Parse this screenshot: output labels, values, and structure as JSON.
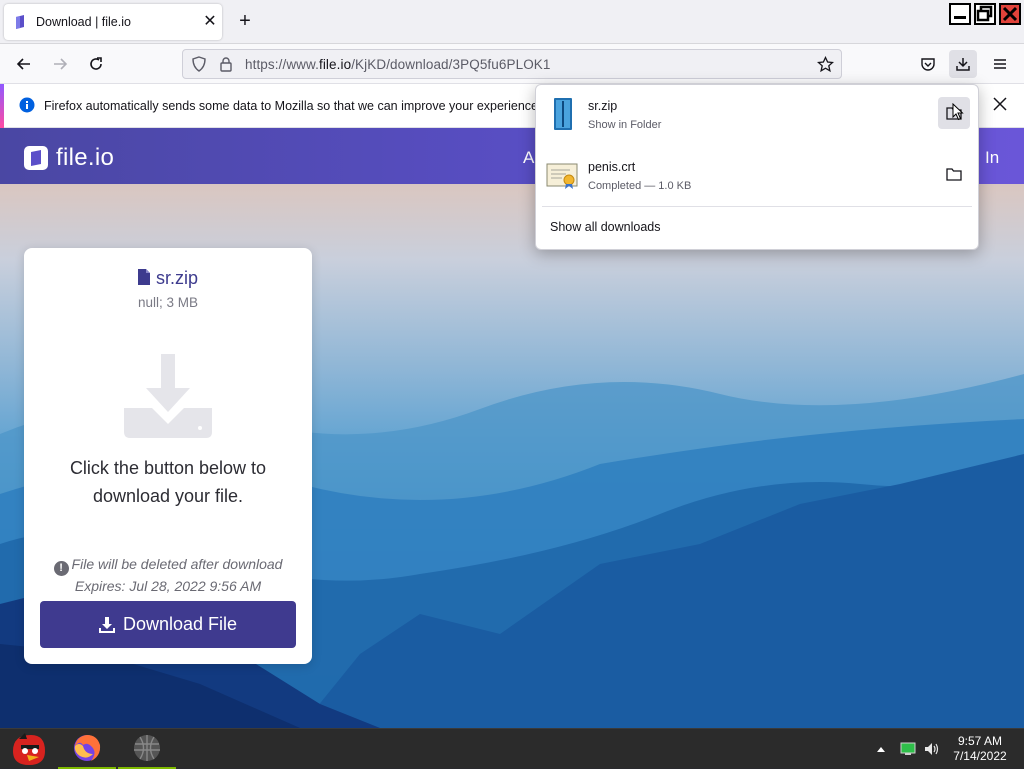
{
  "tab": {
    "title": "Download | file.io",
    "close": "✕",
    "new": "+"
  },
  "urlbar": {
    "prefix": "https://www.",
    "domain": "file.io",
    "path": "/KjKD/download/3PQ5fu6PLOK1"
  },
  "infobar": {
    "message": "Firefox automatically sends some data to Mozilla so that we can improve your experience."
  },
  "site": {
    "logo_text": "file.io",
    "header_link_partial_left": "A",
    "header_link_partial_right": "In"
  },
  "card": {
    "file_name": "sr.zip",
    "file_meta": "null; 3 MB",
    "message": "Click the button below to download your file.",
    "warning_line1": "File will be deleted after download",
    "warning_line2": "Expires: Jul 28, 2022 9:56 AM",
    "button_label": "Download File"
  },
  "downloads_panel": {
    "items": [
      {
        "name": "sr.zip",
        "status": "Show in Folder",
        "icon": "zip-file-icon"
      },
      {
        "name": "penis.crt",
        "status": "Completed — 1.0 KB",
        "icon": "certificate-file-icon"
      }
    ],
    "show_all": "Show all downloads"
  },
  "taskbar": {
    "time": "9:57 AM",
    "date": "7/14/2022"
  },
  "colors": {
    "header": "#5b4fc9",
    "button": "#3f3a8f",
    "accent": "#9059ff"
  }
}
